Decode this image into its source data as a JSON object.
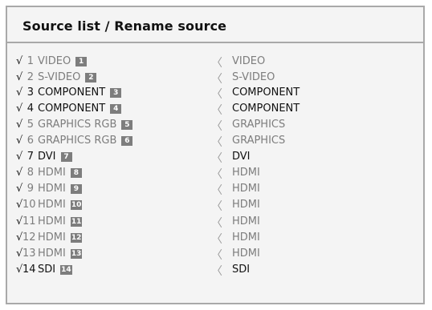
{
  "header": {
    "title": "Source list / Rename source"
  },
  "colors": {
    "frame_border": "#a9a9a9",
    "background": "#f4f4f4",
    "active_text": "#111111",
    "inactive_text": "#7d7d7d",
    "badge_bg": "#7d7d7d"
  },
  "icons": {
    "check": "check-icon",
    "chevron": "chevron-left-icon"
  },
  "sources": [
    {
      "check": "√",
      "num": "1",
      "name": "VIDEO",
      "badge": "1",
      "chevron": "〈",
      "rename": "VIDEO",
      "state": "inactive"
    },
    {
      "check": "√",
      "num": "2",
      "name": "S-VIDEO",
      "badge": "2",
      "chevron": "〈",
      "rename": "S-VIDEO",
      "state": "inactive"
    },
    {
      "check": "√",
      "num": "3",
      "name": "COMPONENT",
      "badge": "3",
      "chevron": "〈",
      "rename": "COMPONENT",
      "state": "active"
    },
    {
      "check": "√",
      "num": "4",
      "name": "COMPONENT",
      "badge": "4",
      "chevron": "〈",
      "rename": "COMPONENT",
      "state": "active"
    },
    {
      "check": "√",
      "num": "5",
      "name": "GRAPHICS RGB",
      "badge": "5",
      "chevron": "〈",
      "rename": "GRAPHICS",
      "state": "inactive"
    },
    {
      "check": "√",
      "num": "6",
      "name": "GRAPHICS RGB",
      "badge": "6",
      "chevron": "〈",
      "rename": "GRAPHICS",
      "state": "inactive"
    },
    {
      "check": "√",
      "num": "7",
      "name": "DVI",
      "badge": "7",
      "chevron": "〈",
      "rename": "DVI",
      "state": "active"
    },
    {
      "check": "√",
      "num": "8",
      "name": "HDMI",
      "badge": "8",
      "chevron": "〈",
      "rename": "HDMI",
      "state": "inactive"
    },
    {
      "check": "√",
      "num": "9",
      "name": "HDMI",
      "badge": "9",
      "chevron": "〈",
      "rename": "HDMI",
      "state": "inactive"
    },
    {
      "check": "√",
      "num": "10",
      "name": "HDMI",
      "badge": "10",
      "chevron": "〈",
      "rename": "HDMI",
      "state": "inactive"
    },
    {
      "check": "√",
      "num": "11",
      "name": "HDMI",
      "badge": "11",
      "chevron": "〈",
      "rename": "HDMI",
      "state": "inactive"
    },
    {
      "check": "√",
      "num": "12",
      "name": "HDMI",
      "badge": "12",
      "chevron": "〈",
      "rename": "HDMI",
      "state": "inactive"
    },
    {
      "check": "√",
      "num": "13",
      "name": "HDMI",
      "badge": "13",
      "chevron": "〈",
      "rename": "HDMI",
      "state": "inactive"
    },
    {
      "check": "√",
      "num": "14",
      "name": "SDI",
      "badge": "14",
      "chevron": "〈",
      "rename": "SDI",
      "state": "active"
    }
  ]
}
